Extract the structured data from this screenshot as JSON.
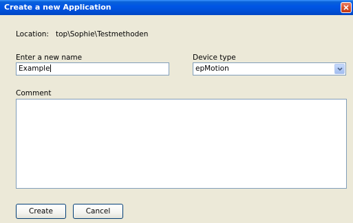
{
  "window": {
    "title": "Create a new Application"
  },
  "location": {
    "label": "Location:",
    "value": "top\\Sophie\\Testmethoden"
  },
  "name": {
    "label": "Enter a new name",
    "value": "Example"
  },
  "device": {
    "label": "Device type",
    "selected": "epMotion"
  },
  "comment": {
    "label": "Comment",
    "value": ""
  },
  "buttons": {
    "create": "Create",
    "cancel": "Cancel"
  },
  "colors": {
    "titlebar": "#0055e5",
    "dialog_bg": "#ece9d8",
    "input_border": "#7f9db9",
    "close_button": "#d8502a"
  },
  "icons": {
    "close": "close-icon",
    "dropdown": "chevron-down-icon"
  }
}
